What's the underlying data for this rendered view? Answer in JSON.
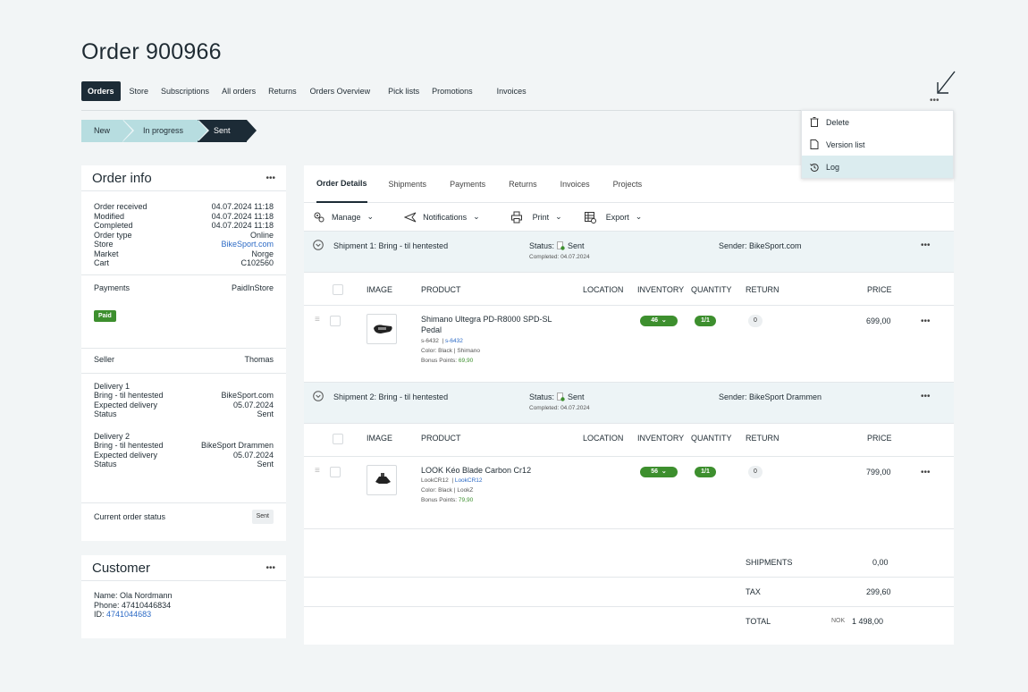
{
  "page": {
    "title": "Order 900966"
  },
  "topnav": [
    "Orders",
    "Store",
    "Subscriptions",
    "All orders",
    "Returns",
    "Orders Overview",
    "Pick lists",
    "Promotions",
    "Invoices"
  ],
  "steps": [
    "New",
    "In progress",
    "Sent"
  ],
  "menu": {
    "dots": "•••",
    "items": [
      {
        "label": "Delete",
        "icon": "trash-icon"
      },
      {
        "label": "Version list",
        "icon": "document-icon"
      },
      {
        "label": "Log",
        "icon": "history-icon"
      }
    ]
  },
  "order_info": {
    "title": "Order info",
    "dots": "•••",
    "rows": [
      {
        "k": "Order received",
        "v": "04.07.2024 11:18"
      },
      {
        "k": "Modified",
        "v": "04.07.2024 11:18"
      },
      {
        "k": "Completed",
        "v": "04.07.2024 11:18"
      },
      {
        "k": "Order type",
        "v": "Online"
      },
      {
        "k": "Store",
        "v": "BikeSport.com"
      },
      {
        "k": "Market",
        "v": "Norge"
      },
      {
        "k": "Cart",
        "v": "C102560"
      }
    ],
    "payments_label": "Payments",
    "payments_value": "PaidInStore",
    "paid_badge": "Paid",
    "seller_label": "Seller",
    "seller_value": "Thomas",
    "delivery1": {
      "title": "Delivery 1",
      "rows": [
        {
          "k": "Bring - til hentested",
          "v": "BikeSport.com"
        },
        {
          "k": "Expected delivery",
          "v": "05.07.2024"
        },
        {
          "k": "Status",
          "v": "Sent"
        }
      ]
    },
    "delivery2": {
      "title": "Delivery 2",
      "rows": [
        {
          "k": "Bring - til hentested",
          "v": "BikeSport Drammen"
        },
        {
          "k": "Expected delivery",
          "v": "05.07.2024"
        },
        {
          "k": "Status",
          "v": "Sent"
        }
      ]
    },
    "current_status_label": "Current order status",
    "current_status_value": "Sent"
  },
  "customer": {
    "title": "Customer",
    "dots": "•••",
    "name": "Name: Ola Nordmann",
    "phone": "Phone: 47410446834",
    "id_label": "ID:",
    "id_value": "4741044683"
  },
  "detail_tabs": [
    "Order Details",
    "Shipments",
    "Payments",
    "Returns",
    "Invoices",
    "Projects"
  ],
  "toolbar": [
    {
      "label": "Manage",
      "icon": "gear-cog-icon"
    },
    {
      "label": "Notifications",
      "icon": "send-icon"
    },
    {
      "label": "Print",
      "icon": "printer-icon"
    },
    {
      "label": "Export",
      "icon": "export-table-icon"
    }
  ],
  "columns": [
    "IMAGE",
    "PRODUCT",
    "LOCATION",
    "INVENTORY",
    "QUANTITY",
    "RETURN",
    "PRICE"
  ],
  "shipments": [
    {
      "title": "Shipment 1: Bring - til hentested",
      "status_label": "Status:",
      "status_value": "Sent",
      "completed_label": "Completed:",
      "completed_value": "04.07.2024",
      "sender": "Sender: BikeSport.com",
      "item": {
        "name_line1": "Shimano Ultegra PD-R8000 SPD-SL",
        "name_line2": "Pedal",
        "sku": "s-6432",
        "sku_link": "s-6432",
        "color_line": "Color: Black  |  Shimano",
        "bonus_label": "Bonus Points:",
        "bonus_value": "69,90",
        "inventory": "46",
        "quantity": "1/1",
        "return": "0",
        "price": "699,00"
      }
    },
    {
      "title": "Shipment 2: Bring - til hentested",
      "status_label": "Status:",
      "status_value": "Sent",
      "completed_label": "Completed:",
      "completed_value": "04.07.2024",
      "sender": "Sender: BikeSport Drammen",
      "item": {
        "name_line1": "LOOK Kéo Blade Carbon Cr12",
        "name_line2": "",
        "sku": "LookCR12",
        "sku_link": "LookCR12",
        "color_line": "Color: Black  |  LookZ",
        "bonus_label": "Bonus Points:",
        "bonus_value": "79,90",
        "inventory": "56",
        "quantity": "1/1",
        "return": "0",
        "price": "799,00"
      }
    }
  ],
  "totals": {
    "shipments_label": "SHIPMENTS",
    "shipments_value": "0,00",
    "tax_label": "TAX",
    "tax_value": "299,60",
    "total_label": "TOTAL",
    "total_currency": "NOK",
    "total_value": "1 498,00"
  },
  "colors": {
    "accent": "#1c2b36",
    "step": "#b7dde0",
    "green": "#3d8f2e",
    "link": "#2c6ac5",
    "highlight": "#dbecef"
  }
}
